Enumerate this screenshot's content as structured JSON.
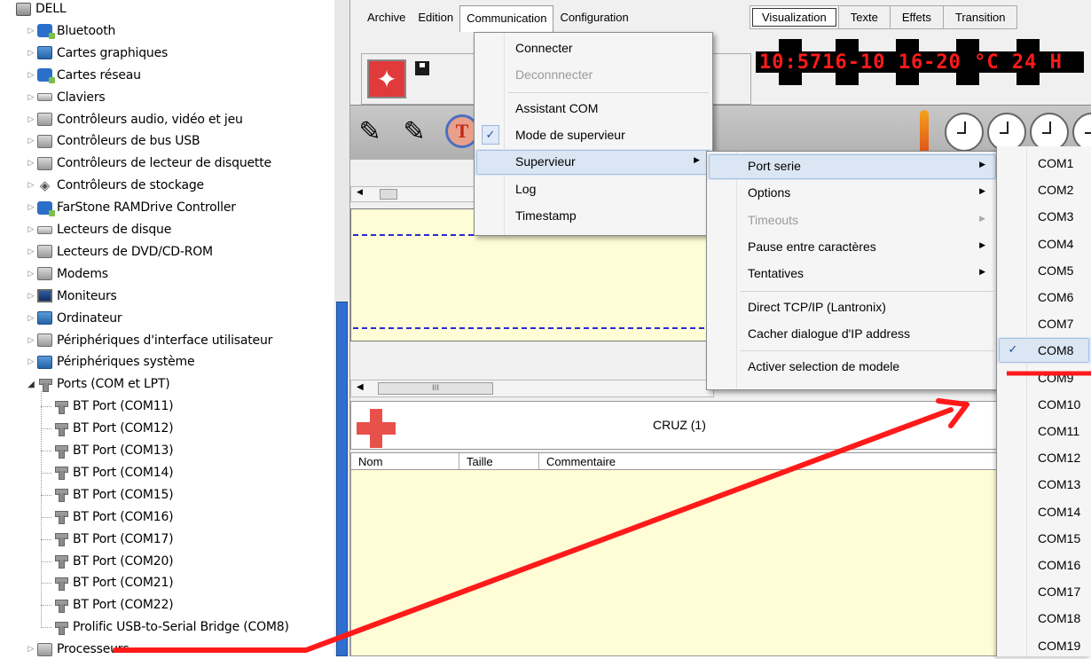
{
  "device_tree": {
    "root": "DELL",
    "categories": [
      {
        "label": "Bluetooth",
        "icon": "bluetooth-icon"
      },
      {
        "label": "Cartes graphiques",
        "icon": "display-adapter-icon"
      },
      {
        "label": "Cartes réseau",
        "icon": "network-adapter-icon"
      },
      {
        "label": "Claviers",
        "icon": "keyboard-icon"
      },
      {
        "label": "Contrôleurs audio, vidéo et jeu",
        "icon": "speaker-icon"
      },
      {
        "label": "Contrôleurs de bus USB",
        "icon": "usb-icon"
      },
      {
        "label": "Contrôleurs de lecteur de disquette",
        "icon": "floppy-controller-icon"
      },
      {
        "label": "Contrôleurs de stockage",
        "icon": "storage-controller-icon"
      },
      {
        "label": "FarStone RAMDrive Controller",
        "icon": "ramdrive-icon"
      },
      {
        "label": "Lecteurs de disque",
        "icon": "disk-drive-icon"
      },
      {
        "label": "Lecteurs de DVD/CD-ROM",
        "icon": "dvd-drive-icon"
      },
      {
        "label": "Modems",
        "icon": "modem-icon"
      },
      {
        "label": "Moniteurs",
        "icon": "monitor-icon"
      },
      {
        "label": "Ordinateur",
        "icon": "computer-icon"
      },
      {
        "label": "Périphériques d'interface utilisateur",
        "icon": "hid-icon"
      },
      {
        "label": "Périphériques système",
        "icon": "system-device-icon"
      }
    ],
    "ports_category": "Ports (COM et LPT)",
    "ports": [
      "BT Port (COM11)",
      "BT Port (COM12)",
      "BT Port (COM13)",
      "BT Port (COM14)",
      "BT Port (COM15)",
      "BT Port (COM16)",
      "BT Port (COM17)",
      "BT Port (COM20)",
      "BT Port (COM21)",
      "BT Port (COM22)",
      "Prolific USB-to-Serial Bridge (COM8)"
    ],
    "last_category": "Processeurs"
  },
  "app": {
    "menubar": [
      "Archive",
      "Edition",
      "Communication",
      "Configuration"
    ],
    "active_menu_index": 2,
    "tabs": [
      "Visualization",
      "Texte",
      "Effets",
      "Transition"
    ],
    "led_display": "10:5716-10  16-20 °C 24 H",
    "cruz_title": "CRUZ (1)",
    "grid_columns": [
      "Nom",
      "Taille",
      "Commentaire"
    ]
  },
  "communication_menu": [
    {
      "label": "Connecter",
      "disabled": false
    },
    {
      "label": "Deconnnecter",
      "disabled": true
    },
    {
      "sep": true
    },
    {
      "label": "Assistant COM",
      "disabled": false
    },
    {
      "label": "Mode de supervieur",
      "checked": true
    },
    {
      "label": "Supervieur",
      "submenu": true,
      "highlighted": true
    },
    {
      "label": "Log"
    },
    {
      "label": "Timestamp"
    }
  ],
  "supervieur_menu": [
    {
      "label": "Port serie",
      "submenu": true,
      "highlighted": true
    },
    {
      "label": "Options",
      "submenu": true
    },
    {
      "label": "Timeouts",
      "submenu": true,
      "disabled": true
    },
    {
      "label": "Pause entre caractères",
      "submenu": true
    },
    {
      "label": "Tentatives",
      "submenu": true
    },
    {
      "sep": true
    },
    {
      "label": "Direct TCP/IP (Lantronix)"
    },
    {
      "label": "Cacher dialogue d'IP address"
    },
    {
      "sep": true
    },
    {
      "label": "Activer selection de modele"
    }
  ],
  "com_ports": [
    "COM1",
    "COM2",
    "COM3",
    "COM4",
    "COM5",
    "COM6",
    "COM7",
    "COM8",
    "COM9",
    "COM10",
    "COM11",
    "COM12",
    "COM13",
    "COM14",
    "COM15",
    "COM16",
    "COM17",
    "COM18",
    "COM19"
  ],
  "selected_com": "COM8",
  "colors": {
    "annotation_red": "#ff1a1a",
    "led_text": "#ff1a1a",
    "selection_blue": "#dbe6f4",
    "panel_yellow": "#fefdd6"
  }
}
